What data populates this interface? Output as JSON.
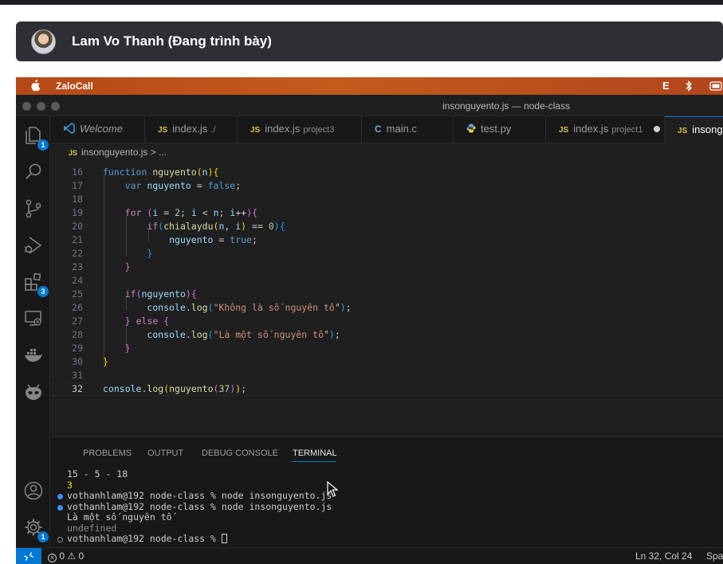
{
  "presenter": {
    "name": "Lam Vo Thanh (Đang trình bày)"
  },
  "mac_menubar": {
    "app": "ZaloCall",
    "input_source": "E"
  },
  "window": {
    "title": "insonguyento.js — node-class"
  },
  "activity_bar": {
    "explorer_badge": "1",
    "extensions_badge": "3",
    "settings_badge": "1"
  },
  "tabs": [
    {
      "icon": "vscode-icon",
      "label": "Welcome",
      "hint": ""
    },
    {
      "icon": "JS",
      "label": "index.js",
      "hint": "./"
    },
    {
      "icon": "JS",
      "label": "index.js",
      "hint": "project3"
    },
    {
      "icon": "C",
      "label": "main.c",
      "hint": ""
    },
    {
      "icon": "python-icon",
      "label": "test.py",
      "hint": ""
    },
    {
      "icon": "JS",
      "label": "index.js",
      "hint": "project1"
    },
    {
      "icon": "JS",
      "label": "insonguyento.js",
      "hint": ""
    }
  ],
  "breadcrumb": {
    "file": "insonguyento.js",
    "rest": "> ..."
  },
  "editor": {
    "lines": [
      {
        "n": "16",
        "text": "function nguyento(n){"
      },
      {
        "n": "17",
        "text": "    var nguyento = false;"
      },
      {
        "n": "18",
        "text": ""
      },
      {
        "n": "19",
        "text": "    for (i = 2; i < n; i++){"
      },
      {
        "n": "20",
        "text": "        if(chialaydu(n, i) == 0){"
      },
      {
        "n": "21",
        "text": "            nguyento = true;"
      },
      {
        "n": "22",
        "text": "        }"
      },
      {
        "n": "23",
        "text": "    }"
      },
      {
        "n": "24",
        "text": ""
      },
      {
        "n": "25",
        "text": "    if(nguyento){"
      },
      {
        "n": "26",
        "text": "        console.log(\"Không là số nguyên tố\");"
      },
      {
        "n": "27",
        "text": "    } else {"
      },
      {
        "n": "28",
        "text": "        console.log(\"Là một số nguyên tố\");"
      },
      {
        "n": "29",
        "text": "    }"
      },
      {
        "n": "30",
        "text": "}"
      },
      {
        "n": "31",
        "text": ""
      },
      {
        "n": "32",
        "text": "console.log(nguyento(37));"
      }
    ]
  },
  "panel": {
    "tabs": [
      "PROBLEMS",
      "OUTPUT",
      "DEBUG CONSOLE",
      "TERMINAL"
    ],
    "active_tab": "TERMINAL",
    "terminal_lines": [
      "15 - 5 - 18",
      "3",
      "vothanhlam@192 node-class % node insonguyento.js",
      "vothanhlam@192 node-class % node insonguyento.js",
      "Là một số nguyên tố",
      "undefined",
      "vothanhlam@192 node-class % "
    ]
  },
  "statusbar": {
    "errors": "0",
    "warnings": "0",
    "position": "Ln 32, Col 24",
    "spaces": "Spa"
  },
  "colors": {
    "accent": "#0078d4",
    "keyword": "#569cd6",
    "control": "#c586c0",
    "function": "#dcdcaa",
    "variable": "#9cdcfe",
    "string": "#ce9178",
    "number": "#b5cea8",
    "class": "#4ec9b0",
    "bracket_gold": "#ffd700",
    "bracket_pink": "#da70d6",
    "bracket_blue": "#179fff"
  }
}
